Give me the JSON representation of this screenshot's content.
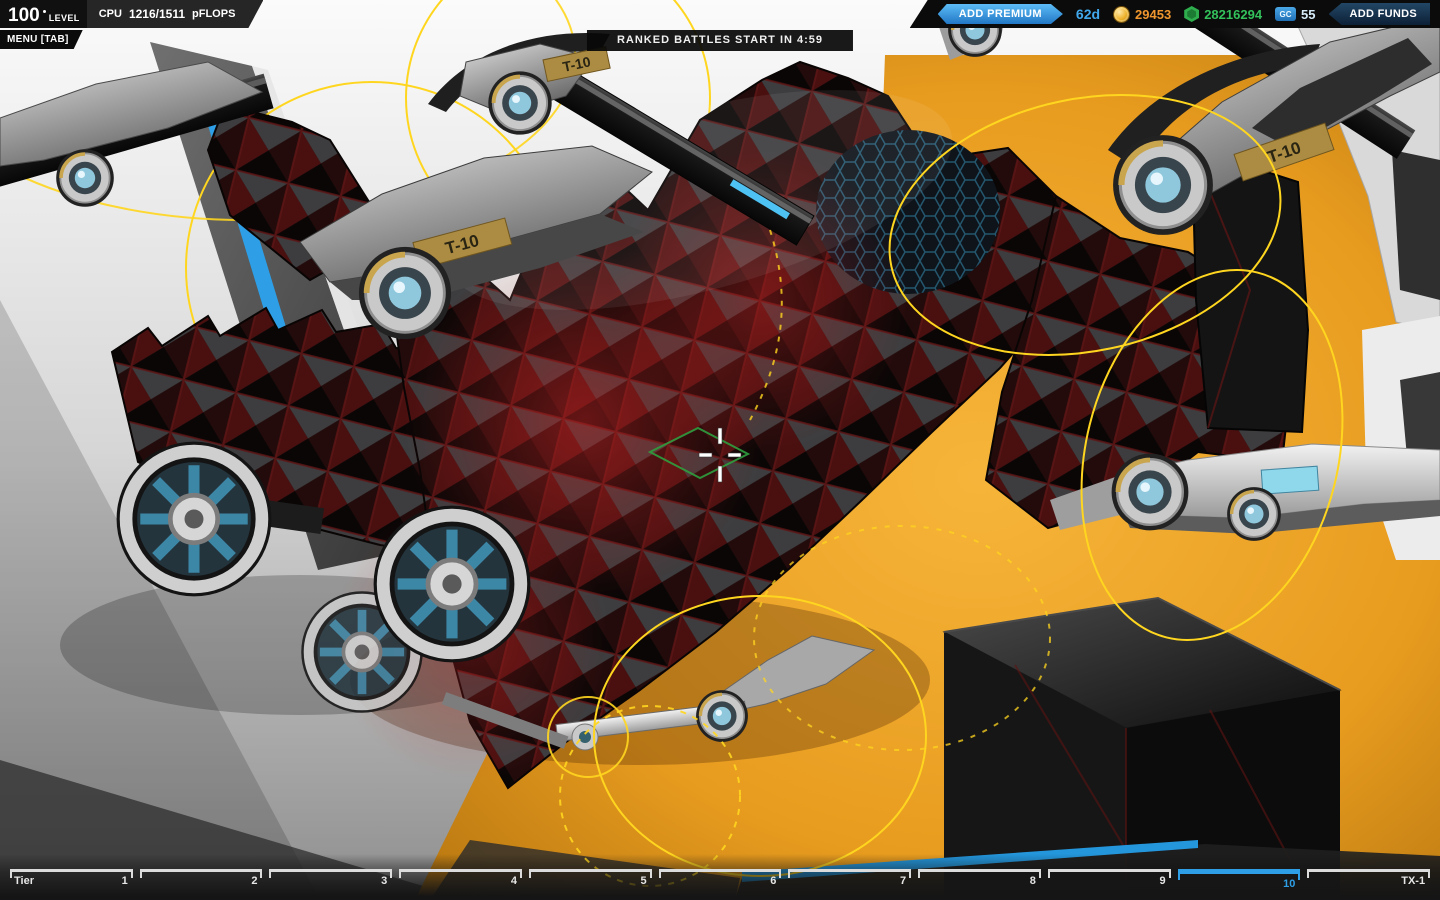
{
  "hud": {
    "level": {
      "value": "100",
      "label": "LEVEL"
    },
    "cpu": {
      "label": "CPU",
      "value": "1216/1511",
      "unit": "pFLOPS"
    },
    "menu_label": "MENU [TAB]",
    "ranked_banner": "RANKED BATTLES START IN 4:59",
    "top_right": {
      "add_premium": "ADD PREMIUM",
      "premium_days": "62d",
      "robits": "29453",
      "parts": "28216294",
      "gc_label": "GC",
      "gc_value": "55",
      "add_funds": "ADD FUNDS"
    }
  },
  "tier_bar": {
    "label": "Tier",
    "active_tier": "10",
    "segments": [
      {
        "label": "1"
      },
      {
        "label": "2"
      },
      {
        "label": "3"
      },
      {
        "label": "4"
      },
      {
        "label": "5"
      },
      {
        "label": "6"
      },
      {
        "label": "7"
      },
      {
        "label": "8"
      },
      {
        "label": "9"
      },
      {
        "label": "10",
        "active": true
      },
      {
        "label": "TX-1"
      }
    ]
  },
  "scene": {
    "turret_labels": [
      "T-10",
      "T-10",
      "T-10"
    ]
  },
  "colors": {
    "accent_blue": "#2e9fe6",
    "premium_blue": "#2f89d8",
    "robits_orange": "#f0962e",
    "parts_green": "#33c15b",
    "gc_blue": "#d7ecf8",
    "guide_yellow": "#ffd61f",
    "floor_orange": "#e89c1f",
    "selection_green": "#2f9e3f"
  }
}
